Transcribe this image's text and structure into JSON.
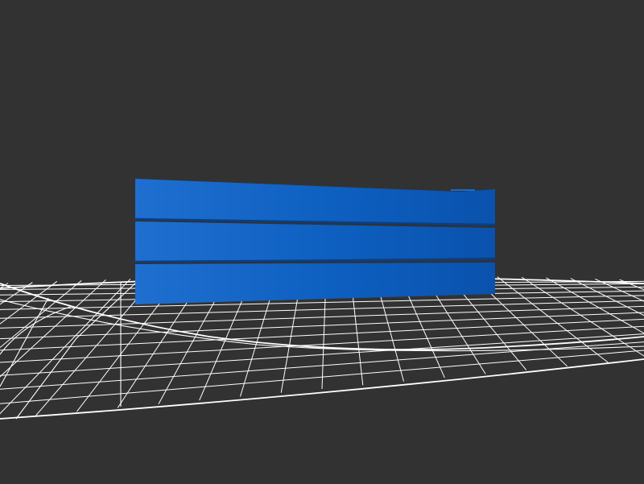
{
  "scene": {
    "background_color": "#323232",
    "ground": {
      "kind": "wireframe-grid",
      "color": "#ffffff"
    },
    "object": {
      "kind": "extruded-plank-stack",
      "plank_count": 3,
      "color": "#0a5bbf",
      "highlight_color": "#2a78d4",
      "shadow_color": "#0a4ea3"
    }
  }
}
